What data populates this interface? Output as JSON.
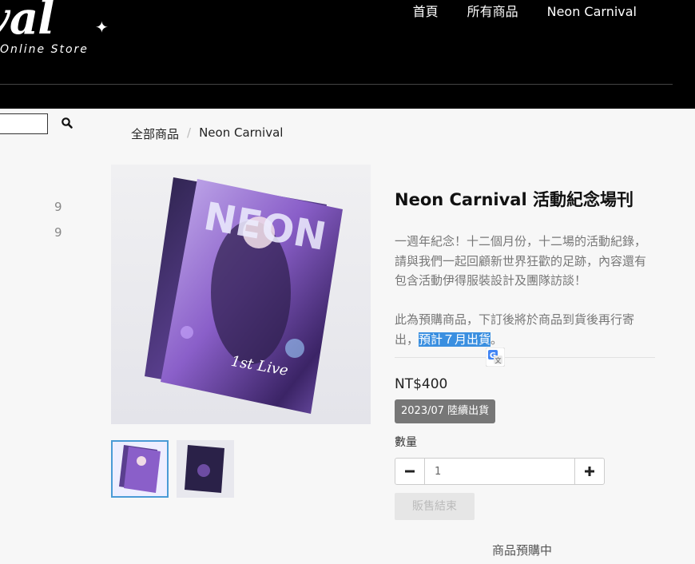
{
  "header": {
    "logo_text": "ival",
    "logo_subtext": "Online Store",
    "nav": [
      "首頁",
      "所有商品",
      "Neon Carnival"
    ]
  },
  "sidebar": {
    "counts": [
      "9",
      "9"
    ]
  },
  "breadcrumb": [
    "全部商品",
    "/",
    "Neon Carnival"
  ],
  "product": {
    "title": "Neon Carnival 活動紀念場刊",
    "description_p1": "一週年紀念！十二個月份，十二場的活動紀錄，請與我們一起回顧新世界狂歡的足跡，內容還有包含活動伊得服裝設計及團隊訪談！",
    "description_p2_before": "此為預購商品，下訂後將於商品到貨後再行寄出，",
    "description_p2_highlight": "預計７月出貨",
    "description_p2_after": "。",
    "price": "NT$400",
    "badge": "2023/07 陸續出貨",
    "quantity_label": "數量",
    "quantity_value": "1",
    "sold_out_label": "販售結束",
    "preorder_label": "商品預購中",
    "cover_text": "NEON",
    "cover_subtitle": "1st Live"
  },
  "icons": {
    "search": "search-icon",
    "translate": "google-translate-icon",
    "minus": "minus-icon",
    "plus": "plus-icon"
  },
  "colors": {
    "header_bg": "#000000",
    "accent_highlight": "#3a8fe0",
    "badge_bg": "#777777",
    "thumb_active_border": "#4a9bd6"
  }
}
